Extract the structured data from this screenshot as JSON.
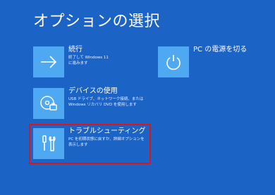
{
  "page": {
    "title": "オプションの選択"
  },
  "options": {
    "continue": {
      "title": "続行",
      "desc_line1": "終了して Windows 11",
      "desc_line2": "に進みます",
      "icon": "arrow-right-icon"
    },
    "device": {
      "title": "デバイスの使用",
      "desc_line1": "USB ドライブ、ネットワーク接続、または",
      "desc_line2": "Windows リカバリ DVD を使用します",
      "icon": "disc-device-icon"
    },
    "troubleshoot": {
      "title": "トラブルシューティング",
      "desc_line1": "PC を初期状態に戻すか、詳細オプションを",
      "desc_line2": "表示します",
      "icon": "tools-icon"
    },
    "power_off": {
      "title": "PC の電源を切る",
      "icon": "power-icon"
    }
  },
  "colors": {
    "background": "#1c63c6",
    "tile": "#4fa9f2",
    "highlight": "#e01414"
  }
}
